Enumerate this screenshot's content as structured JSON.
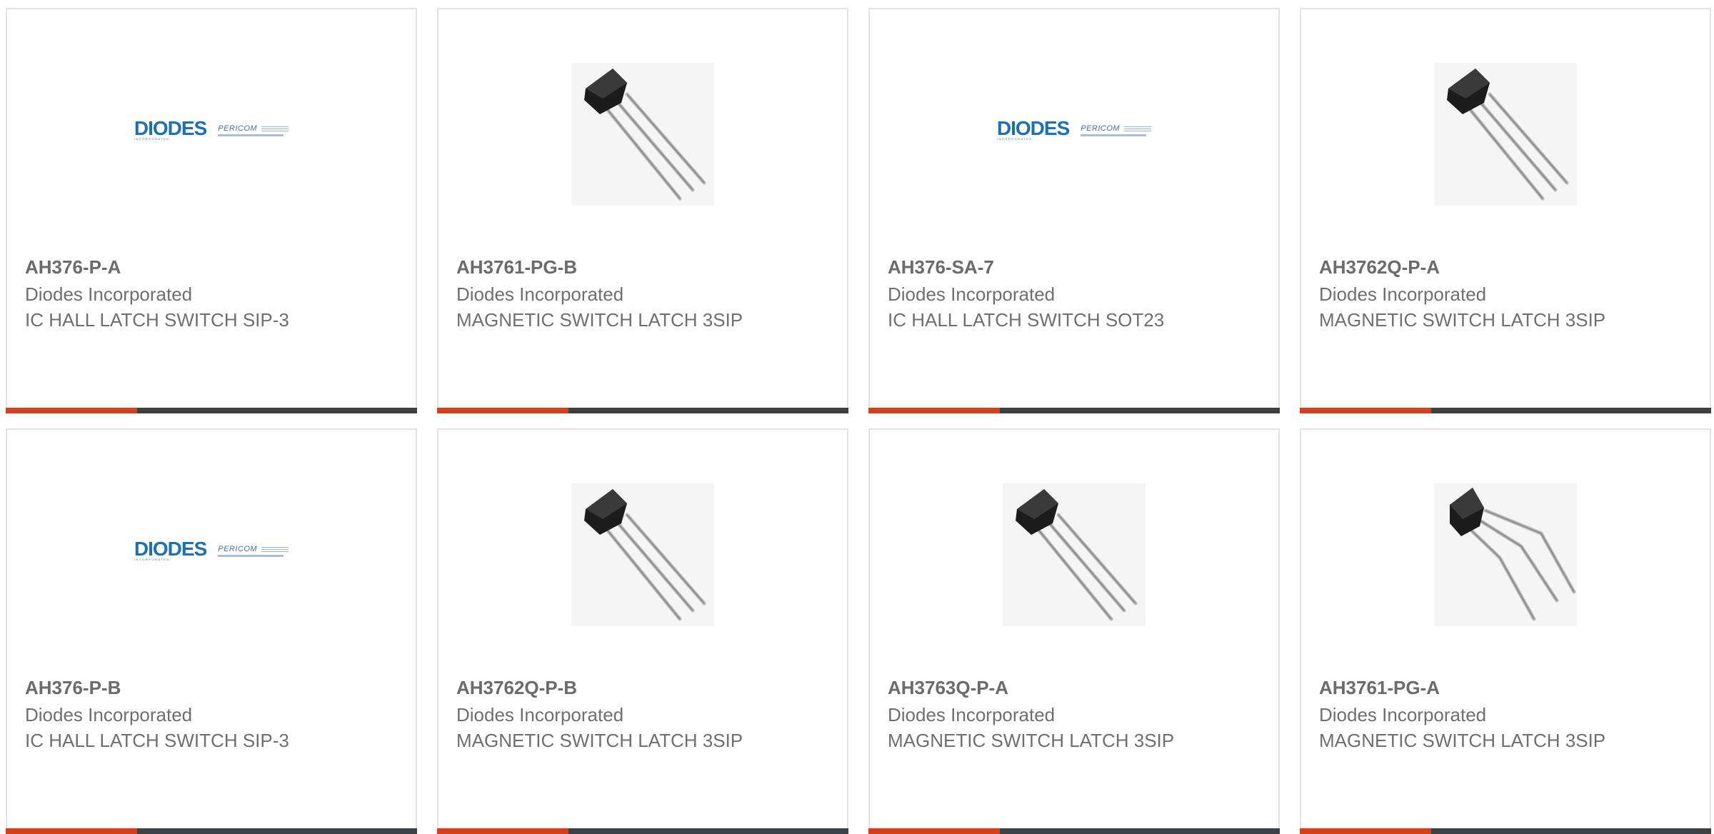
{
  "brand": {
    "logo_text": "DIODES",
    "logo_subtext": "INCORPORATED",
    "partner_text": "PERICOM"
  },
  "colors": {
    "accent": "#d53f1a",
    "bar": "#3d4144",
    "logo_blue": "#1d6fb6"
  },
  "products": [
    {
      "part": "AH376-P-A",
      "manufacturer": "Diodes Incorporated",
      "description": "IC HALL LATCH SWITCH SIP-3",
      "image": "diodes-logo"
    },
    {
      "part": "AH3761-PG-B",
      "manufacturer": "Diodes Incorporated",
      "description": "MAGNETIC SWITCH LATCH 3SIP",
      "image": "to92-transistor"
    },
    {
      "part": "AH376-SA-7",
      "manufacturer": "Diodes Incorporated",
      "description": "IC HALL LATCH SWITCH SOT23",
      "image": "diodes-logo"
    },
    {
      "part": "AH3762Q-P-A",
      "manufacturer": "Diodes Incorporated",
      "description": "MAGNETIC SWITCH LATCH 3SIP",
      "image": "to92-transistor"
    },
    {
      "part": "AH376-P-B",
      "manufacturer": "Diodes Incorporated",
      "description": "IC HALL LATCH SWITCH SIP-3",
      "image": "diodes-logo"
    },
    {
      "part": "AH3762Q-P-B",
      "manufacturer": "Diodes Incorporated",
      "description": "MAGNETIC SWITCH LATCH 3SIP",
      "image": "to92-transistor"
    },
    {
      "part": "AH3763Q-P-A",
      "manufacturer": "Diodes Incorporated",
      "description": "MAGNETIC SWITCH LATCH 3SIP",
      "image": "to92-transistor"
    },
    {
      "part": "AH3761-PG-A",
      "manufacturer": "Diodes Incorporated",
      "description": "MAGNETIC SWITCH LATCH 3SIP",
      "image": "sip-bent-leads"
    }
  ]
}
